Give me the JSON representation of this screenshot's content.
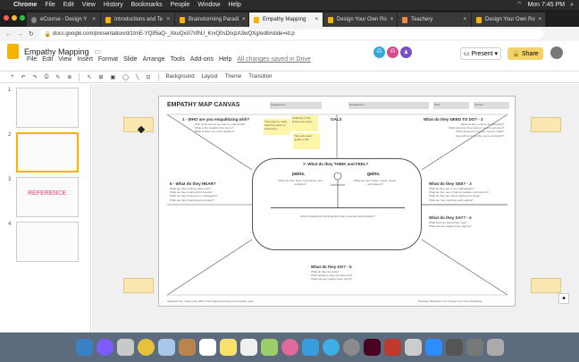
{
  "menubar": {
    "apple": "",
    "app": "Chrome",
    "items": [
      "File",
      "Edit",
      "View",
      "History",
      "Bookmarks",
      "People",
      "Window",
      "Help"
    ],
    "clock": "Mon 7:45 PM"
  },
  "tabs": [
    {
      "label": "eCourse - Design Y",
      "active": false
    },
    {
      "label": "Introductions and Te",
      "active": false
    },
    {
      "label": "Brainstorming Paradi",
      "active": false
    },
    {
      "label": "Empathy Mapping",
      "active": true
    },
    {
      "label": "Design Your Own Ro",
      "active": false
    },
    {
      "label": "Teachery",
      "active": false
    },
    {
      "label": "Design Your Own Ro",
      "active": false
    }
  ],
  "address": {
    "url": "docs.google.com/presentation/d/1tmE-YQ95aQ-_XkuQxi07nfhU_KrvQ0sDIxjzA3wQXg/edit#slide=id.p"
  },
  "doc": {
    "title": "Empathy Mapping",
    "menus": [
      "File",
      "Edit",
      "View",
      "Insert",
      "Format",
      "Slide",
      "Arrange",
      "Tools",
      "Add-ons",
      "Help"
    ],
    "saved": "All changes saved in Drive"
  },
  "buttons": {
    "present": "Present",
    "share": "Share"
  },
  "toolbar": {
    "background": "Background",
    "layout": "Layout",
    "theme": "Theme",
    "transition": "Transition"
  },
  "slides": [
    "1",
    "2",
    "3",
    "4"
  ],
  "thumb3_label": "REFERENCE",
  "map": {
    "header": "EMPATHY MAP CANVAS",
    "fields": [
      "Designed for:",
      "Designed by:",
      "Date:",
      "Version:"
    ],
    "who": "1 - WHO are you empathizing with?",
    "who_lines": [
      "Who is the person we want to understand?",
      "What is the situation they are in?",
      "What is their role in the situation?"
    ],
    "goals": "OALS",
    "need": "What do they NEED TO DO? - 2",
    "need_lines": [
      "What do they need to do differently?",
      "What job(s) do they want or need to get done?",
      "What decision(s) do they need to make?",
      "How will we know they were successful?"
    ],
    "see": "What do they SEE? - 3",
    "see_lines": [
      "What do they see in the marketplace?",
      "What do they see in their immediate environment?",
      "What do they see others saying and doing?",
      "What are they watching and reading?"
    ],
    "say": "What do they SAY? - 4",
    "say_lines": [
      "What have we heard them say?",
      "What can we imagine them saying?"
    ],
    "hear": "6 - What do they HEAR?",
    "hear_lines": [
      "What are they hearing others say?",
      "What are they hearing from friends?",
      "What are they hearing from colleagues?",
      "What are they hearing second-hand?"
    ],
    "do": "What do they DO? - 5",
    "do_lines": [
      "What do they do today?",
      "What behavior have we observed?",
      "What can we imagine them doing?"
    ],
    "think": "7- What do they THINK and FEEL?",
    "pains": "pains.",
    "gains": "gains.",
    "pains_text": "What are their fears, frustrations, and anxieties?",
    "gains_text": "What are their wants, needs, hopes, and dreams?",
    "other": "Other thoughts and feelings that might motivate their behavior?",
    "footer_left": "Adapted from: Dave Gray (2017) http://gamestorming.com/empathy-map",
    "footer_right": "Paradigm Behavior LLC | Design Your Own Roadmap",
    "sticky": [
      "They want to make teaching easier to implement",
      "Students in this lesson are active",
      "They also want quality of life"
    ]
  }
}
